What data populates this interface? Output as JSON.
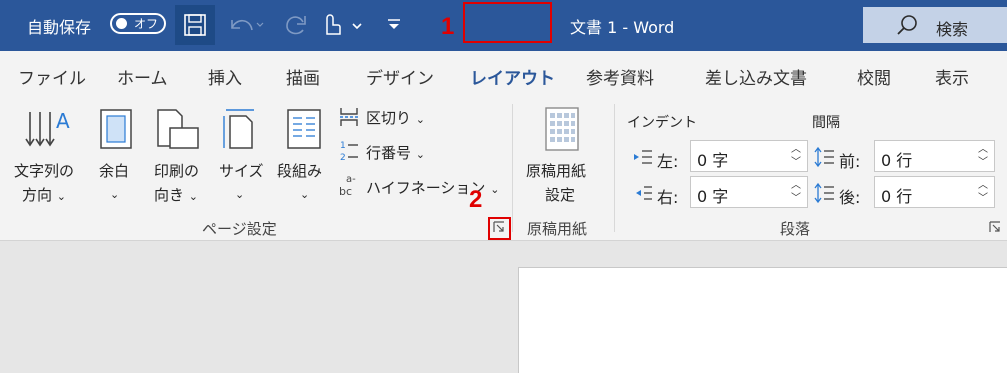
{
  "titlebar": {
    "autosave_label": "自動保存",
    "autosave_state": "オフ",
    "doc_title": "文書 1  -  Word",
    "search_label": "検索"
  },
  "tabs": [
    "ファイル",
    "ホーム",
    "挿入",
    "描画",
    "デザイン",
    "レイアウト",
    "参考資料",
    "差し込み文書",
    "校閲",
    "表示"
  ],
  "active_tab": "レイアウト",
  "callouts": {
    "one": "1",
    "two": "2"
  },
  "ribbon": {
    "page_setup": {
      "text_direction": [
        "文字列の",
        "方向"
      ],
      "margins": [
        "余白"
      ],
      "orientation": [
        "印刷の",
        "向き"
      ],
      "size": [
        "サイズ"
      ],
      "columns": [
        "段組み"
      ],
      "breaks": "区切り",
      "line_numbers": "行番号",
      "hyphenation": "ハイフネーション",
      "group_label": "ページ設定"
    },
    "genko": {
      "settings": [
        "原稿用紙",
        "設定"
      ],
      "group_label": "原稿用紙"
    },
    "paragraph": {
      "indent_header": "インデント",
      "spacing_header": "間隔",
      "left_label": "左:",
      "right_label": "右:",
      "before_label": "前:",
      "after_label": "後:",
      "left_value": "0 字",
      "right_value": "0 字",
      "before_value": "0 行",
      "after_value": "0 行",
      "group_label": "段落"
    }
  },
  "colors": {
    "titlebar": "#2b579a",
    "ribbon": "#f3f3f3",
    "callout": "#e00000"
  }
}
